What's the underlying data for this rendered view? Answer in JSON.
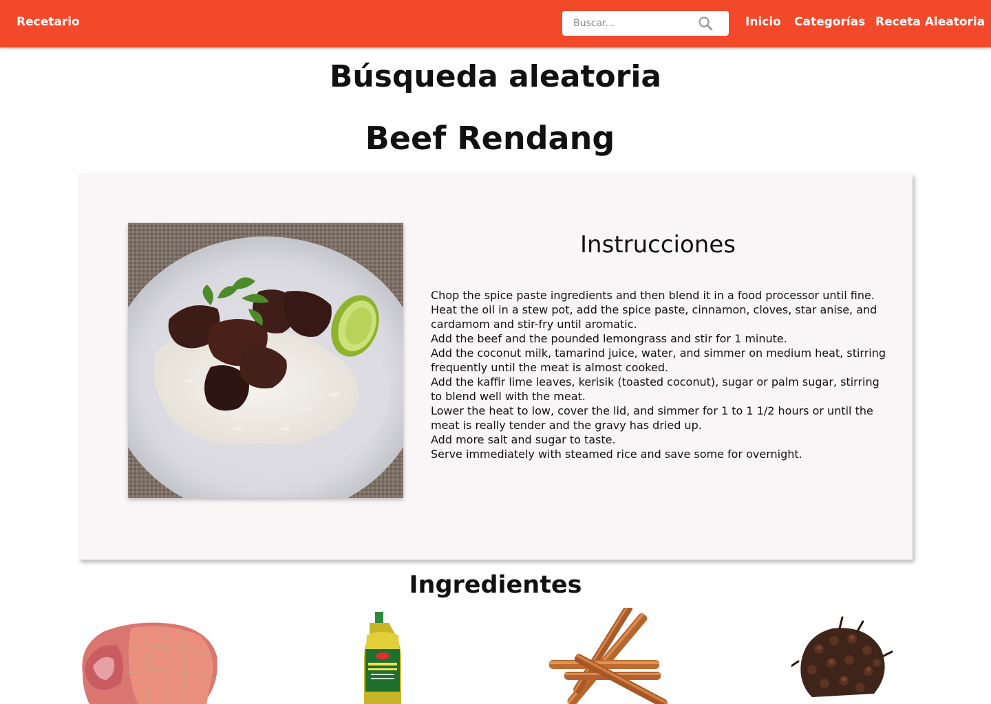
{
  "navbar": {
    "brand": "Recetario",
    "search_placeholder": "Buscar...",
    "links": [
      "Inicio",
      "Categorías",
      "Receta Aleatoria"
    ],
    "color": "#f2492b"
  },
  "page": {
    "title": "Búsqueda aleatoria"
  },
  "recipe": {
    "name": "Beef Rendang",
    "instructions_heading": "Instrucciones",
    "instructions": [
      "Chop the spice paste ingredients and then blend it in a food processor until fine.",
      "Heat the oil in a stew pot, add the spice paste, cinnamon, cloves, star anise, and cardamom and stir-fry until aromatic.",
      "Add the beef and the pounded lemongrass and stir for 1 minute.",
      "Add the coconut milk, tamarind juice, water, and simmer on medium heat, stirring frequently until the meat is almost cooked.",
      "Add the kaffir lime leaves, kerisik (toasted coconut), sugar or palm sugar, stirring to blend well with the meat.",
      "Lower the heat to low, cover the lid, and simmer for 1 to 1 1/2 hours or until the meat is really tender and the gravy has dried up.",
      "Add more salt and sugar to taste.",
      "Serve immediately with steamed rice and save some for overnight."
    ]
  },
  "ingredients": {
    "heading": "Ingredientes",
    "images": [
      "beef-image",
      "vegetable-oil-image",
      "cinnamon-image",
      "cloves-image"
    ]
  },
  "icons": {
    "search": "search-icon"
  }
}
